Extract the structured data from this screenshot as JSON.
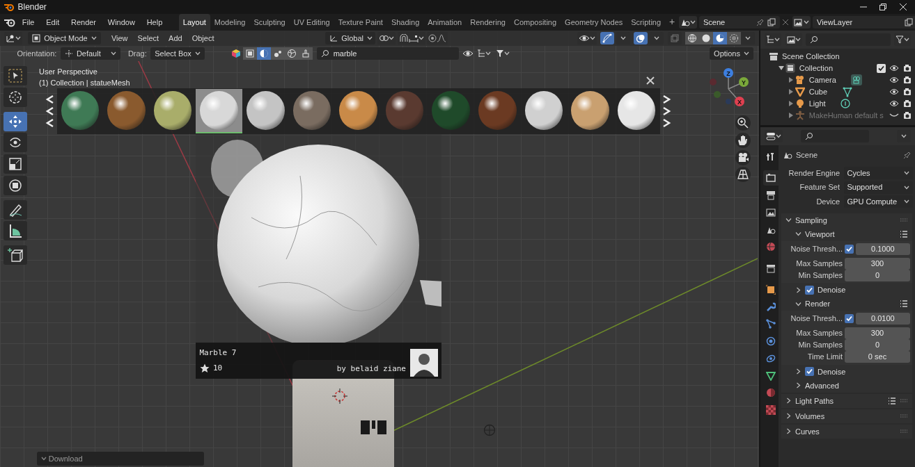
{
  "title_bar": {
    "app": "Blender"
  },
  "menu": [
    "File",
    "Edit",
    "Render",
    "Window",
    "Help"
  ],
  "workspaces": [
    {
      "label": "Layout",
      "selected": true
    },
    {
      "label": "Modeling",
      "selected": false
    },
    {
      "label": "Sculpting",
      "selected": false
    },
    {
      "label": "UV Editing",
      "selected": false
    },
    {
      "label": "Texture Paint",
      "selected": false
    },
    {
      "label": "Shading",
      "selected": false
    },
    {
      "label": "Animation",
      "selected": false
    },
    {
      "label": "Rendering",
      "selected": false
    },
    {
      "label": "Compositing",
      "selected": false
    },
    {
      "label": "Geometry Nodes",
      "selected": false
    },
    {
      "label": "Scripting",
      "selected": false
    }
  ],
  "add_workspace": "+",
  "scene": "Scene",
  "view_layer": "ViewLayer",
  "viewport": {
    "mode": "Object Mode",
    "menus": [
      "View",
      "Select",
      "Add",
      "Object"
    ],
    "transform": "Global",
    "shading_modes": [
      {
        "kind": "wireframe",
        "selected": false
      },
      {
        "kind": "solid",
        "selected": false
      },
      {
        "kind": "material",
        "selected": true
      },
      {
        "kind": "rendered",
        "selected": false
      }
    ],
    "orientation_label": "Orientation:",
    "orientation": "Default",
    "drag_label": "Drag:",
    "drag": "Select Box",
    "asset_filters": [
      {
        "kind": "object",
        "selected": false
      },
      {
        "kind": "material",
        "selected": true
      },
      {
        "kind": "particles",
        "selected": false
      },
      {
        "kind": "world",
        "selected": false
      },
      {
        "kind": "brush",
        "selected": false
      }
    ],
    "search": "marble",
    "options": "Options",
    "tools": [
      {
        "kind": "select",
        "selected": false
      },
      {
        "kind": "cursor",
        "selected": false
      },
      {
        "kind": "move",
        "selected": true
      },
      {
        "kind": "rotate",
        "selected": false
      },
      {
        "kind": "scale",
        "selected": false
      },
      {
        "kind": "transform",
        "selected": false
      },
      {
        "kind": "annotate",
        "selected": false
      },
      {
        "kind": "measure",
        "selected": false
      },
      {
        "kind": "add_cube",
        "selected": false
      }
    ],
    "overlay_lines": [
      "User Perspective",
      "(1) Collection | statueMesh"
    ],
    "materials": [
      {
        "color": "#3f7a55",
        "selected": false
      },
      {
        "color": "#8a5a2e",
        "selected": false
      },
      {
        "color": "#a9ad6a",
        "selected": false
      },
      {
        "color": "#d8d8d8",
        "selected": true
      },
      {
        "color": "#c4c4c4",
        "selected": false
      },
      {
        "color": "#7a6c60",
        "selected": false
      },
      {
        "color": "#c98a48",
        "selected": false
      },
      {
        "color": "#5a3a30",
        "selected": false
      },
      {
        "color": "#1f4a2a",
        "selected": false
      },
      {
        "color": "#6b3a22",
        "selected": false
      },
      {
        "color": "#d0d0d0",
        "selected": false
      },
      {
        "color": "#c9a070",
        "selected": false
      },
      {
        "color": "#e6e6e6",
        "selected": false
      }
    ],
    "preview": {
      "name": "Marble 7",
      "likes": "10",
      "author": "by belaid ziane"
    },
    "gizmo_labels": [
      "Z",
      "Y",
      "X"
    ],
    "download": "Download"
  },
  "outliner": {
    "items": [
      {
        "name": "Scene Collection",
        "kind": "scene_collection",
        "children": [
          {
            "name": "Collection",
            "kind": "collection",
            "expanded": true,
            "checked": true,
            "children": [
              {
                "name": "Camera",
                "kind": "camera",
                "expanded": false,
                "hidden": false
              },
              {
                "name": "Cube",
                "kind": "mesh",
                "expanded": false,
                "hidden": false
              },
              {
                "name": "Light",
                "kind": "light",
                "expanded": false,
                "hidden": false
              },
              {
                "name": "MakeHuman default s",
                "kind": "armature",
                "expanded": false,
                "hidden": true
              }
            ]
          }
        ]
      }
    ]
  },
  "properties": {
    "tabs": [
      {
        "kind": "tool",
        "selected": false
      },
      {
        "kind": "render",
        "selected": true
      },
      {
        "kind": "output",
        "selected": false
      },
      {
        "kind": "view_layer",
        "selected": false
      },
      {
        "kind": "scene",
        "selected": false
      },
      {
        "kind": "world",
        "selected": false
      },
      {
        "kind": "collection",
        "selected": false
      },
      {
        "kind": "object",
        "selected": false
      },
      {
        "kind": "modifier",
        "selected": false
      },
      {
        "kind": "particles",
        "selected": false
      },
      {
        "kind": "physics",
        "selected": false
      },
      {
        "kind": "constraints",
        "selected": false
      },
      {
        "kind": "data",
        "selected": false
      },
      {
        "kind": "material",
        "selected": false
      },
      {
        "kind": "texture",
        "selected": false
      }
    ],
    "context": "Scene",
    "fields": [
      {
        "label": "Render Engine",
        "value": "Cycles"
      },
      {
        "label": "Feature Set",
        "value": "Supported"
      },
      {
        "label": "Device",
        "value": "GPU Compute"
      }
    ],
    "panels": [
      {
        "title": "Sampling",
        "expanded": true,
        "subpanels": [
          {
            "title": "Viewport",
            "expanded": true,
            "presets": true,
            "rows": [
              {
                "label": "Noise Thresh...",
                "checked": true,
                "value": "0.1000"
              },
              {
                "label": "Max Samples",
                "value": "300"
              },
              {
                "label": "Min Samples",
                "value": "0"
              }
            ]
          },
          {
            "title": "Denoise",
            "expanded": false,
            "checked": true
          },
          {
            "title": "Render",
            "expanded": true,
            "presets": true,
            "rows": [
              {
                "label": "Noise Thresh...",
                "checked": true,
                "value": "0.0100"
              },
              {
                "label": "Max Samples",
                "value": "300"
              },
              {
                "label": "Min Samples",
                "value": "0"
              },
              {
                "label": "Time Limit",
                "value": "0 sec"
              }
            ]
          },
          {
            "title": "Denoise",
            "expanded": false,
            "checked": true
          },
          {
            "title": "Advanced",
            "expanded": false
          }
        ]
      },
      {
        "title": "Light Paths",
        "expanded": false,
        "presets": true
      },
      {
        "title": "Volumes",
        "expanded": false
      },
      {
        "title": "Curves",
        "expanded": false
      }
    ]
  }
}
